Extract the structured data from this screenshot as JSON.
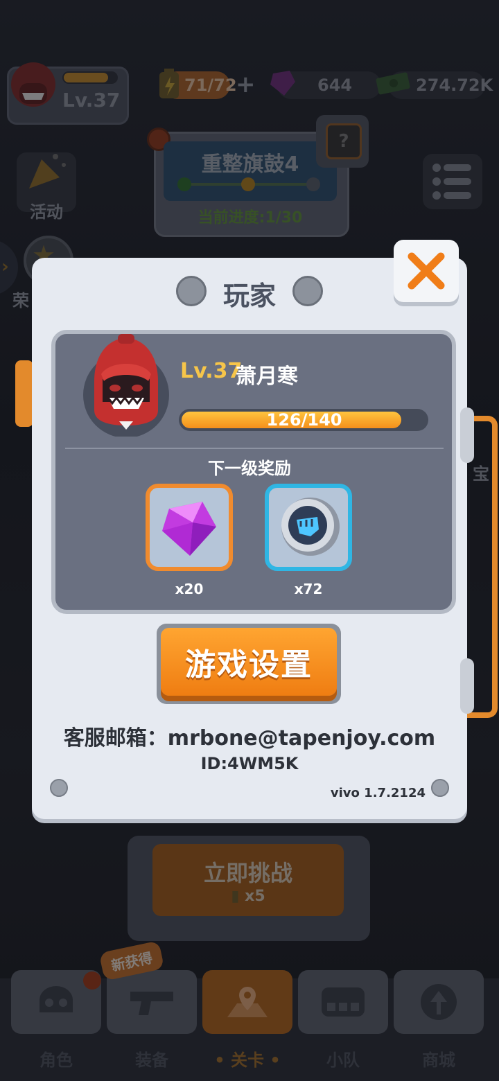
{
  "top_bar": {
    "level": "Lv.37",
    "energy": "71/72",
    "gems": "644",
    "cash": "274.72K"
  },
  "stage_card": {
    "title": "重整旗鼓4",
    "progress": "当前进度:1/30"
  },
  "side": {
    "activity_label": "活动",
    "honor_label": "荣",
    "treasure_label": "宝"
  },
  "modal": {
    "title": "玩家",
    "player_level": "Lv.37",
    "player_name": "萧月寒",
    "xp_text": "126/140",
    "xp_fraction": 0.9,
    "next_reward_label": "下一级奖励",
    "rewards": [
      {
        "icon": "gem-icon",
        "qty": "x20"
      },
      {
        "icon": "fist-coin-icon",
        "qty": "x72"
      }
    ],
    "settings_button": "游戏设置",
    "email": "客服邮箱：mrbone@tapenjoy.com",
    "id": "ID:4WM5K",
    "version": "vivo 1.7.2124"
  },
  "challenge": {
    "label": "立即挑战",
    "cost": "x5"
  },
  "new_badge": "新获得",
  "nav": [
    {
      "label": "角色",
      "icon": "skull-icon"
    },
    {
      "label": "装备",
      "icon": "gun-icon"
    },
    {
      "label": "关卡",
      "icon": "map-pin-icon",
      "active": true
    },
    {
      "label": "小队",
      "icon": "squad-icon"
    },
    {
      "label": "商城",
      "icon": "shop-icon"
    }
  ],
  "colors": {
    "accent_orange": "#f08b2e",
    "accent_blue": "#2fb6e4",
    "gold": "#f6c54a"
  }
}
